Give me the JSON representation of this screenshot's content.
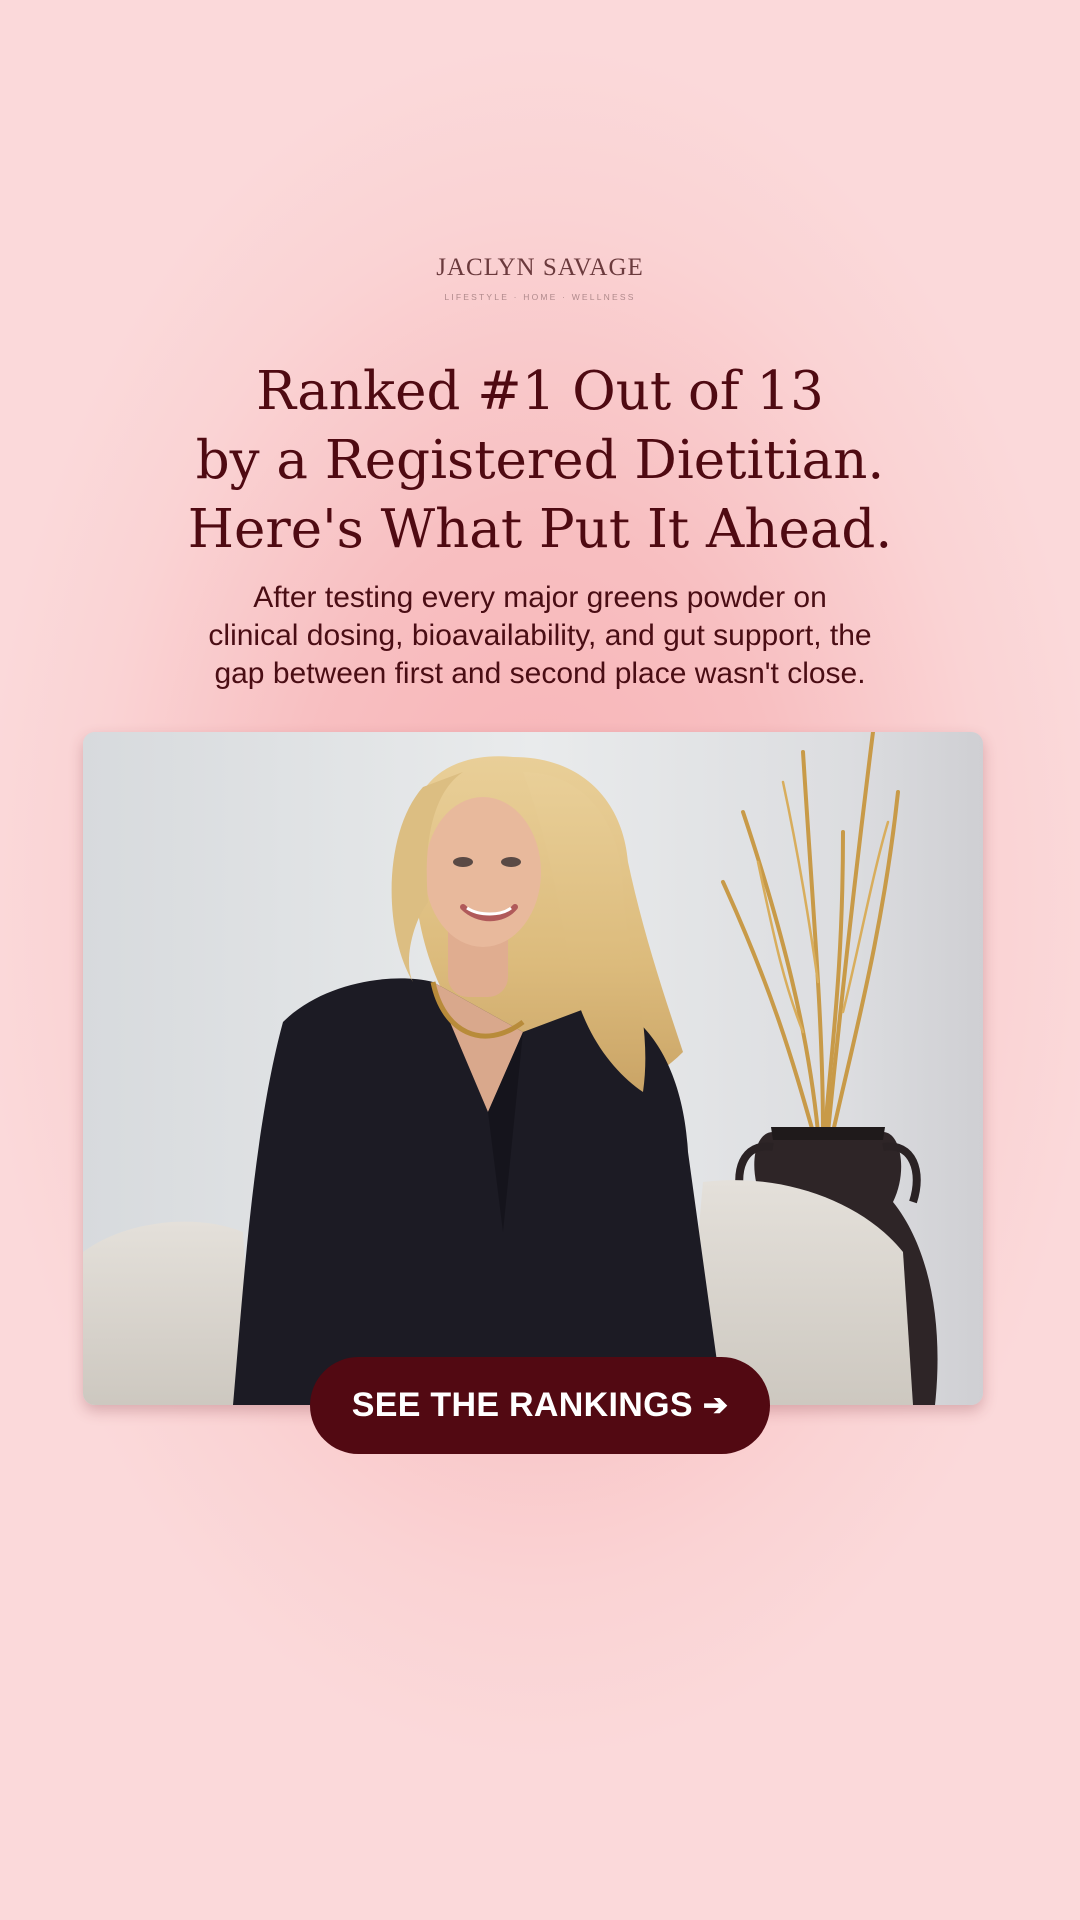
{
  "brand": {
    "name": "JACLYN SAVAGE",
    "tagline": "LIFESTYLE · HOME · WELLNESS"
  },
  "headline": {
    "line1": "Ranked #1 Out of 13",
    "line2": "by a Registered Dietitian.",
    "line3": "Here's What Put It Ahead."
  },
  "subhead": {
    "line1": "After testing every major greens powder on",
    "line2": "clinical dosing, bioavailability, and gut support, the",
    "line3": "gap between first and second place wasn't close."
  },
  "photo": {
    "subject": "portrait of smiling blonde woman in black blouse seated in cream armchair beside dark vase with dried golden branches"
  },
  "cta": {
    "label": "SEE THE RANKINGS",
    "icon": "arrow-right-icon",
    "arrow": "➔"
  },
  "colors": {
    "background": "#fbd9da",
    "glow": "#f7b3b6",
    "headline": "#4f0a12",
    "button": "#520912",
    "button_text": "#ffffff"
  }
}
